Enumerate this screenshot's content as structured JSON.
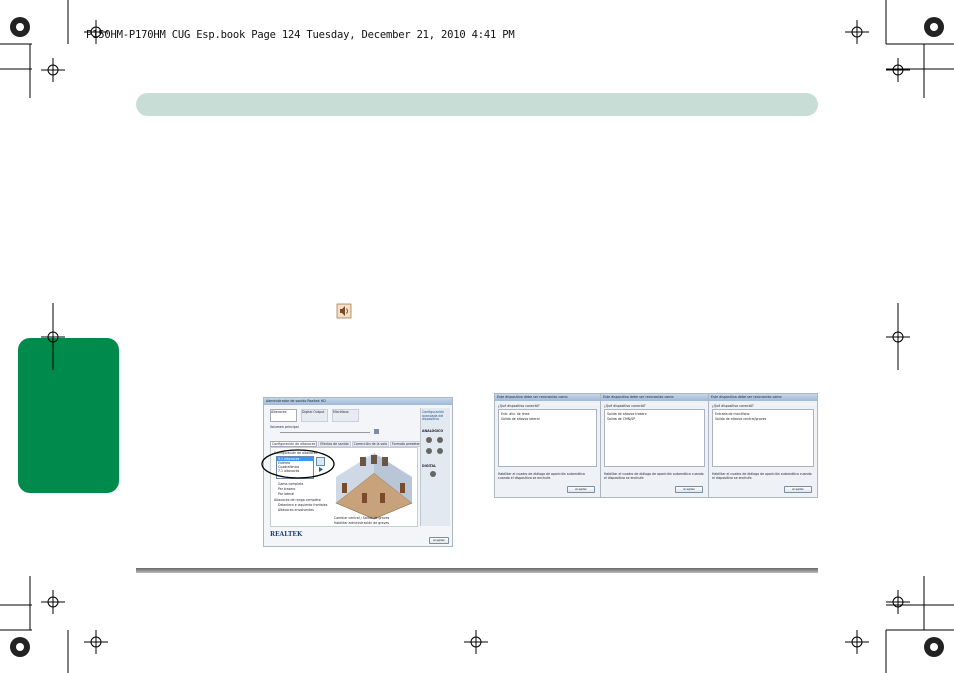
{
  "header": {
    "file_line": "P150HM-P170HM CUG Esp.book  Page 124  Tuesday, December 21, 2010  4:41 PM"
  },
  "realtek_panel": {
    "window_title": "Administrador de sonido Realtek HD",
    "tabs": [
      "Altavoces",
      "Digital Output",
      "Micrófono"
    ],
    "volume_label": "Volumen principal",
    "subtabs": [
      "Configuración de altavoces",
      "Efectos de sonido",
      "Corrección de la sala",
      "Formato predeterminado"
    ],
    "config_label": "Configuración de altavoces",
    "config_options": [
      "Estéreo",
      "Cuadrafónico",
      "5.1 altavoces",
      "7.1 altavoces"
    ],
    "config_selected": "5.1 altavoces",
    "speaker_opts": [
      "Gama completa",
      "Par trasero",
      "Par lateral"
    ],
    "bass_label": "Altavoces de rango completo",
    "bass_opts": [
      "Delantero e izquierdo frontales",
      "Altavoces envolventes"
    ],
    "swap_opts": [
      "Cambiar central / Salida de graves",
      "Habilitar administración de graves"
    ],
    "right_header": "Configuración avanzada del dispositivo",
    "analog_label": "ANALÓGICO",
    "digital_label": "DIGITAL",
    "brand": "REALTEK",
    "ok_button": "Aceptar"
  },
  "dialogs": [
    {
      "title": "Este dispositivo debe ser reconocido como",
      "question": "¿Qué dispositivo conectó?",
      "options": [
        "Entr. aliv. de línea",
        "Salida de altavoz lateral"
      ],
      "checkbox": "Habilitar el cuadro de diálogo de aparición automática cuando el dispositivo se enchufe.",
      "ok": "Aceptar"
    },
    {
      "title": "Este dispositivo debe ser reconocido como",
      "question": "¿Qué dispositivo conectó?",
      "options": [
        "Salida de altavoz trasero",
        "Salida de CMN/SP"
      ],
      "checkbox": "Habilitar el cuadro de diálogo de aparición automática cuando el dispositivo se enchufe.",
      "ok": "Aceptar"
    },
    {
      "title": "Este dispositivo debe ser reconocido como",
      "question": "¿Qué dispositivo conectó?",
      "options": [
        "Entrada de micrófono",
        "Salida de altavoz central/graves"
      ],
      "checkbox": "Habilitar el cuadro de diálogo de aparición automática cuando el dispositivo se enchufe.",
      "ok": "Aceptar"
    }
  ],
  "colors": {
    "band": "#c9ddd7",
    "side_tab": "#008a4c",
    "rule": "#777777"
  },
  "icons": [
    "crop-registration-mark-icon",
    "speaker-icon",
    "radial-target-icon"
  ]
}
